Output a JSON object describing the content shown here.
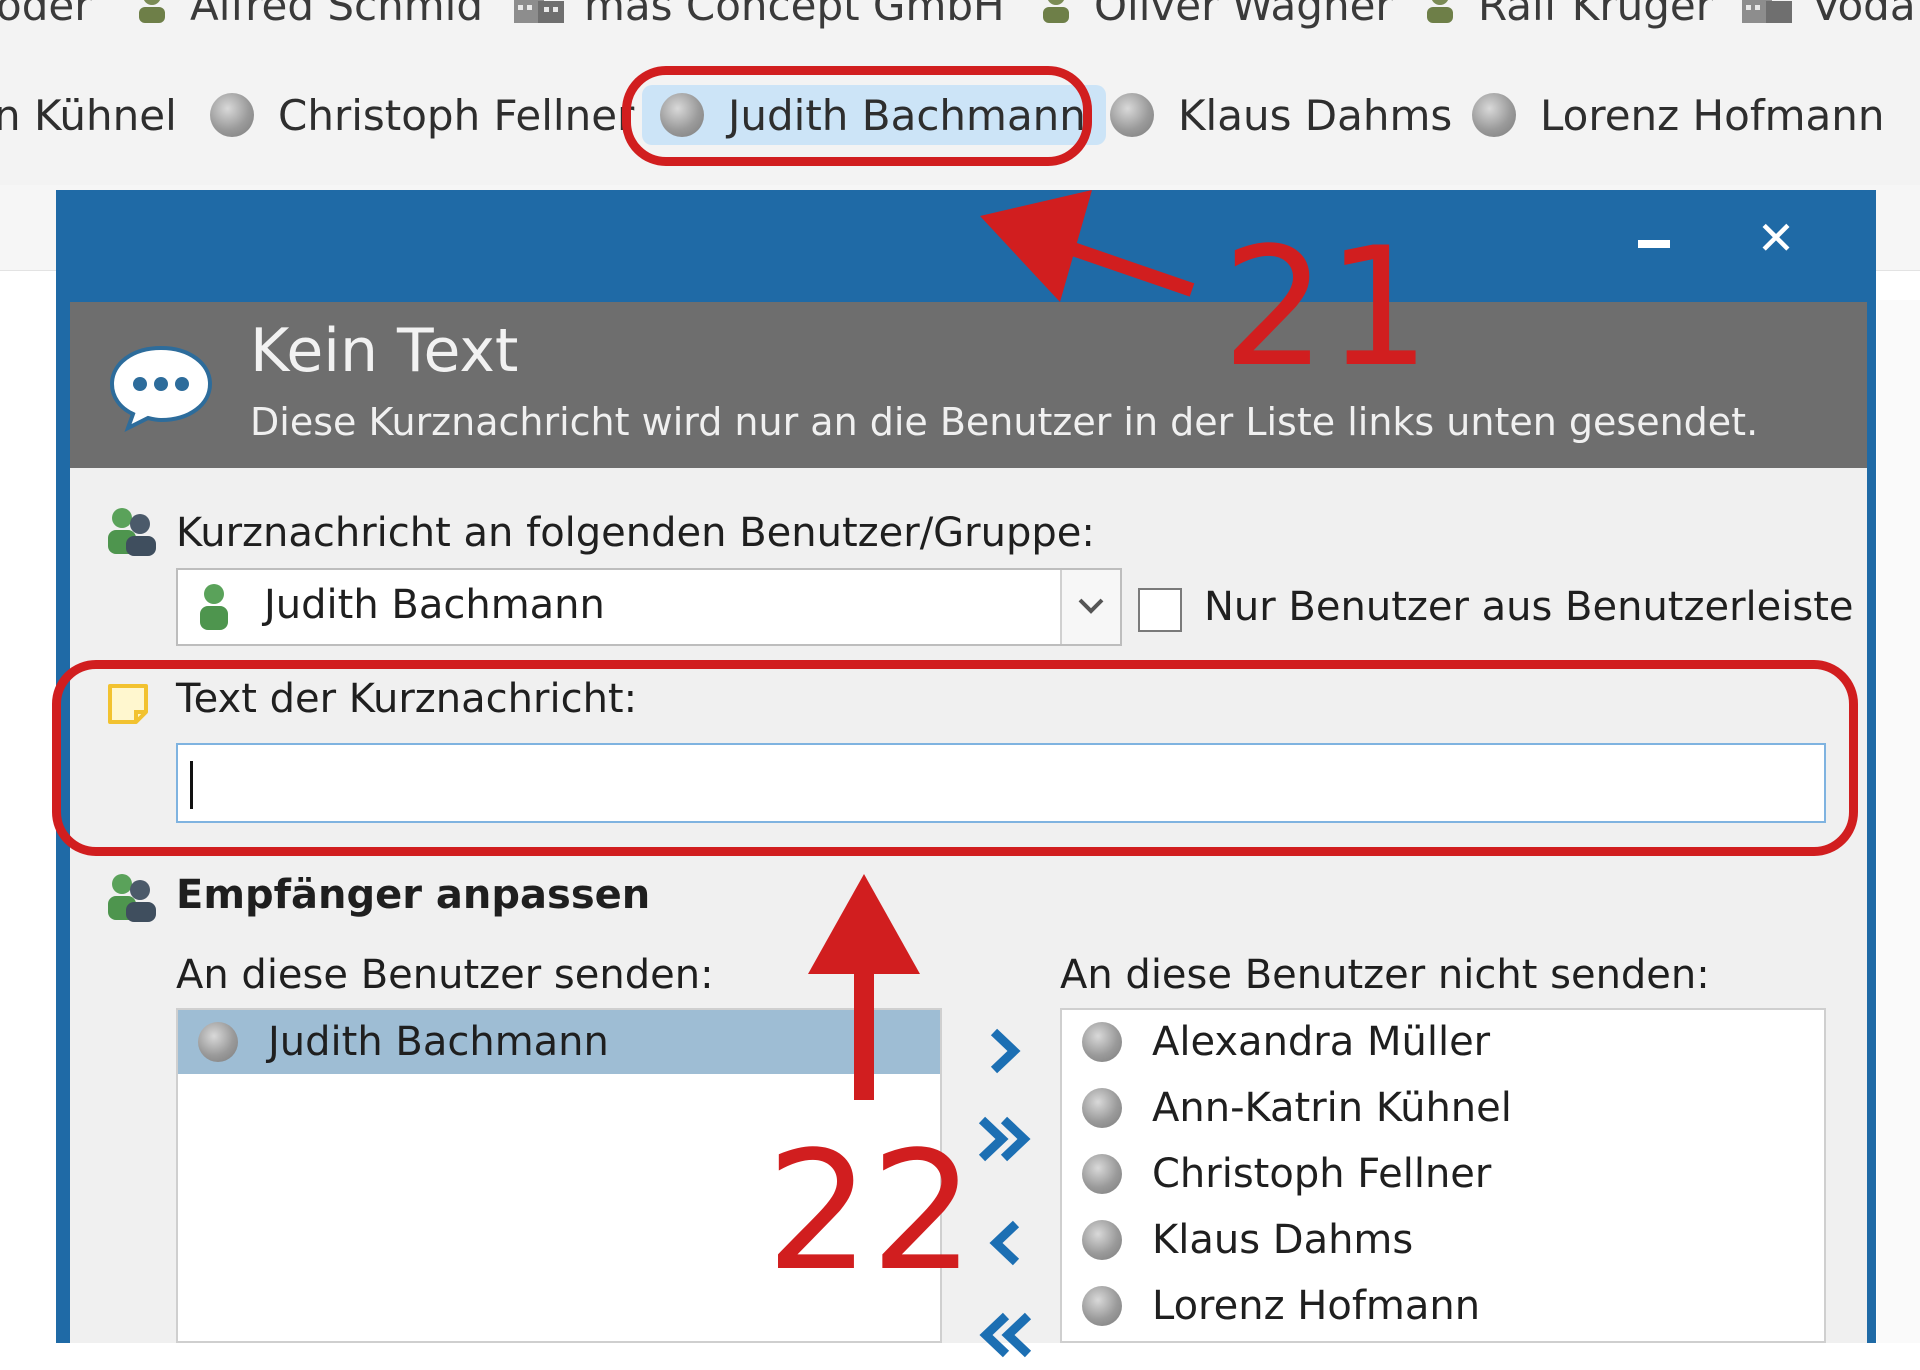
{
  "top_bar_row1": {
    "items": [
      {
        "label": "oder",
        "icon": "none"
      },
      {
        "label": "Alfred Schmid",
        "icon": "person-icon"
      },
      {
        "label": "mas Concept GmbH",
        "icon": "building-icon"
      },
      {
        "label": "Oliver Wagner",
        "icon": "person-icon"
      },
      {
        "label": "Ralf Krüger",
        "icon": "person-icon"
      },
      {
        "label": "Voda",
        "icon": "building-icon"
      }
    ]
  },
  "user_bar": {
    "items": [
      {
        "label": "n Kühnel"
      },
      {
        "label": "Christoph Fellner"
      },
      {
        "label": "Judith Bachmann",
        "selected": true
      },
      {
        "label": "Klaus Dahms"
      },
      {
        "label": "Lorenz Hofmann"
      }
    ]
  },
  "dialog": {
    "title": "Kein Text",
    "subtitle": "Diese Kurznachricht wird nur an die Benutzer in der Liste links unten gesendet.",
    "recipient_label": "Kurznachricht an folgenden Benutzer/Gruppe:",
    "recipient_value": "Judith Bachmann",
    "only_userbar_label": "Nur Benutzer aus Benutzerleiste",
    "only_userbar_checked": false,
    "message_label": "Text der Kurznachricht:",
    "message_value": "",
    "customize_label": "Empfänger anpassen",
    "send_to_label": "An diese Benutzer senden:",
    "not_send_label": "An diese Benutzer nicht senden:",
    "send_to_list": [
      "Judith Bachmann"
    ],
    "not_send_list": [
      "Alexandra Müller",
      "Ann-Katrin Kühnel",
      "Christoph Fellner",
      "Klaus Dahms",
      "Lorenz Hofmann"
    ]
  },
  "annotations": {
    "callout_1": "21",
    "callout_2": "22",
    "color": "#d11e1f"
  },
  "colors": {
    "dialog_frame": "#1f6aa6",
    "header_band": "#6e6e6e",
    "selected_row": "#9ebdd4",
    "selected_chip": "#cce4f7",
    "arrow_blue": "#1c6fb3"
  }
}
